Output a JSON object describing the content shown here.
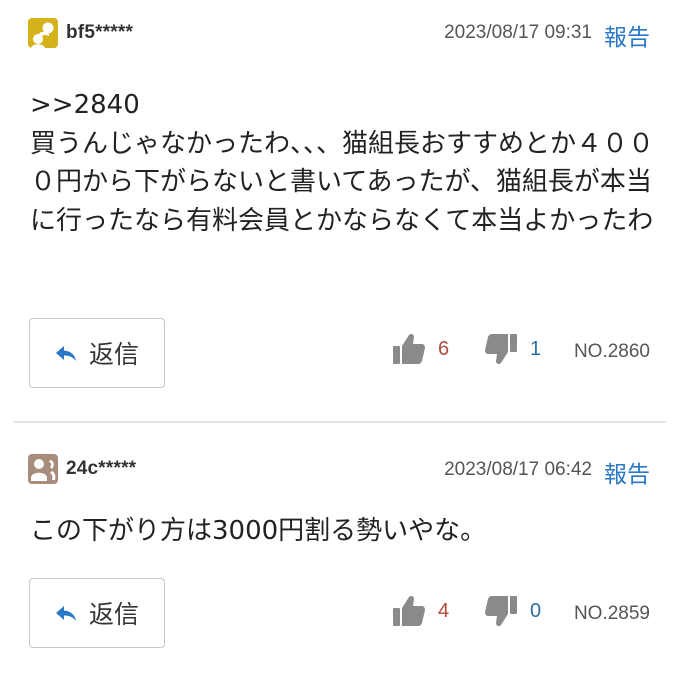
{
  "comments": [
    {
      "username": "bf5*****",
      "timestamp": "2023/08/17 09:31",
      "report_label": "報告",
      "body": ">>2840\n買うんじゃなかったわ、、、猫組長おすすめとか４０００円から下がらないと書いてあったが、猫組長が本当に行ったなら有料会員とかならなくて本当よかったわ",
      "reply_label": "返信",
      "upvotes": "6",
      "downvotes": "1",
      "post_number": "NO.2860",
      "avatar_icon": "yellow-person-avatar-icon"
    },
    {
      "username": "24c*****",
      "timestamp": "2023/08/17 06:42",
      "report_label": "報告",
      "body": "この下がり方は3000円割る勢いやな。",
      "reply_label": "返信",
      "upvotes": "4",
      "downvotes": "0",
      "post_number": "NO.2859",
      "avatar_icon": "brown-person-avatar-icon"
    }
  ],
  "colors": {
    "link": "#2a78c6",
    "upvote_count": "#b54a3a",
    "downvote_count": "#2a6fa6",
    "thumb_icon": "#8a8a8a",
    "avatar_yellow": "#d3b21c",
    "avatar_brown": "#a88c7c"
  }
}
